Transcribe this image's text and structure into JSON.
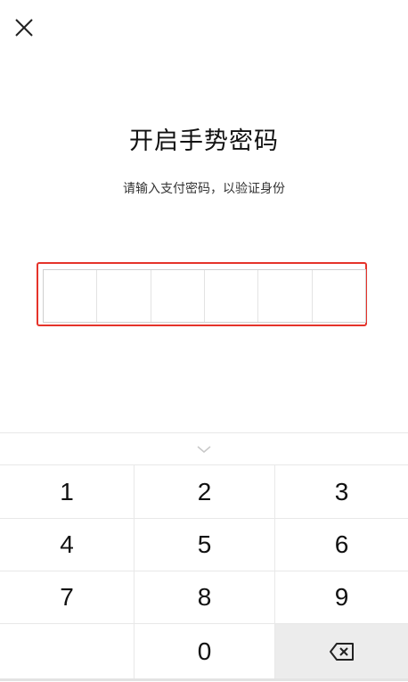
{
  "header": {
    "close_icon": "close-icon"
  },
  "main": {
    "title": "开启手势密码",
    "subtitle": "请输入支付密码，以验证身份",
    "pin_length": 6,
    "highlight_color": "#e5332a"
  },
  "keypad": {
    "collapse_icon": "chevron-down-icon",
    "keys": [
      "1",
      "2",
      "3",
      "4",
      "5",
      "6",
      "7",
      "8",
      "9",
      "",
      "0",
      ""
    ],
    "delete_icon": "backspace-icon"
  }
}
